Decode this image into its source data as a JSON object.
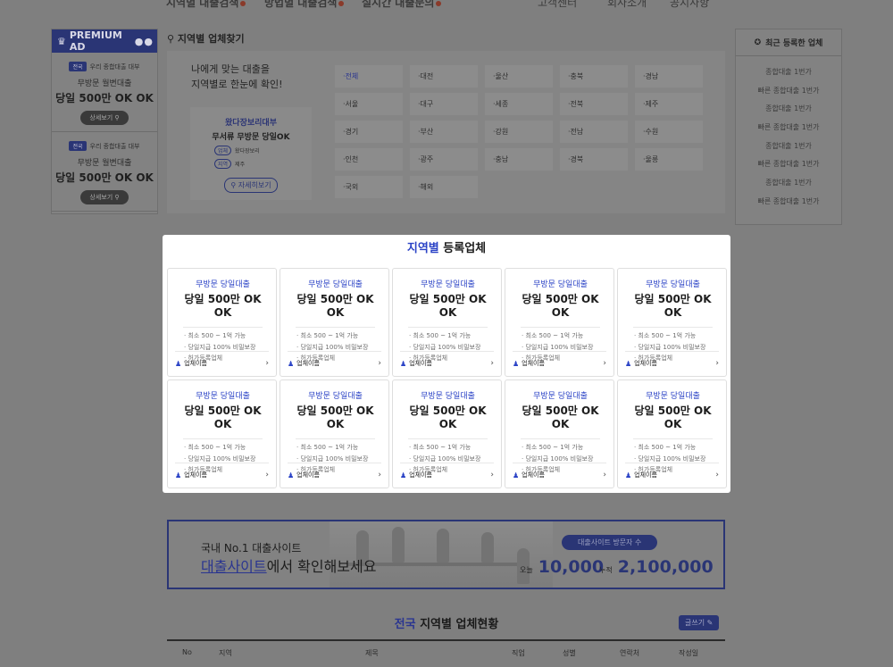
{
  "topnav": {
    "items": [
      "지역별 대출검색",
      "방법별 대출검색",
      "실시간 대출문의",
      "고객센터",
      "회사소개",
      "공지사항"
    ]
  },
  "premium": {
    "title": "PREMIUM AD",
    "cards": [
      {
        "tag": "전국",
        "company": "우리 종합대출 대부",
        "line": "무방문 월변대출",
        "big": "당일 500만 OK OK",
        "button": "상세보기"
      },
      {
        "tag": "전국",
        "company": "우리 종합대출 대부",
        "line": "무방문 월변대출",
        "big": "당일 500만 OK OK",
        "button": "상세보기"
      }
    ]
  },
  "finder": {
    "title": "지역별 업체찾기",
    "lead1": "나에게 맞는 대출을",
    "lead2": "지역별로 한눈에 확인!",
    "card": {
      "company": "왔다장보리대부",
      "headline": "무서류 무방문 당일OK",
      "row1_tag": "업체",
      "row1_val": "왔다장보리",
      "row2_tag": "지역",
      "row2_val": "제주",
      "button": "자세히보기"
    },
    "regions": [
      "전체",
      "대전",
      "울산",
      "충북",
      "경남",
      "서울",
      "대구",
      "세종",
      "전북",
      "제주",
      "경기",
      "부산",
      "강원",
      "전남",
      "수원",
      "인천",
      "광주",
      "충남",
      "경북",
      "울릉",
      "국외",
      "해외"
    ]
  },
  "recent": {
    "title": "최근 등록한 업체",
    "items": [
      "종합대출 1번가",
      "빠른 종합대출 1번가",
      "종합대출 1번가",
      "빠른 종합대출 1번가",
      "종합대출 1번가",
      "빠른 종합대출 1번가",
      "종합대출 1번가",
      "빠른 종합대출 1번가"
    ]
  },
  "modal": {
    "title_highlight": "지역별",
    "title_rest": " 등록업체",
    "card": {
      "sub": "무방문 당일대출",
      "main": "당일 500만 OK OK",
      "features": [
        "· 최소 500 ~ 1억 가능",
        "· 당일지급 100% 비밀보장",
        "· 허가등록업체"
      ],
      "company": "업체이름"
    }
  },
  "banner": {
    "line1": "국내 No.1 대출사이트",
    "line2_highlight": "대출사이트",
    "line2_rest": "에서 확인해보세요",
    "pill": "대출사이트 방문자 수",
    "today_label": "오늘",
    "today_value": "10,000",
    "total_label": "누적",
    "total_value": "2,100,000"
  },
  "status": {
    "title_highlight": "전국",
    "title_rest": " 지역별 업체현황",
    "write_button": "글쓰기",
    "columns": [
      "No",
      "지역",
      "제목",
      "직업",
      "성별",
      "연락처",
      "작성일"
    ]
  }
}
